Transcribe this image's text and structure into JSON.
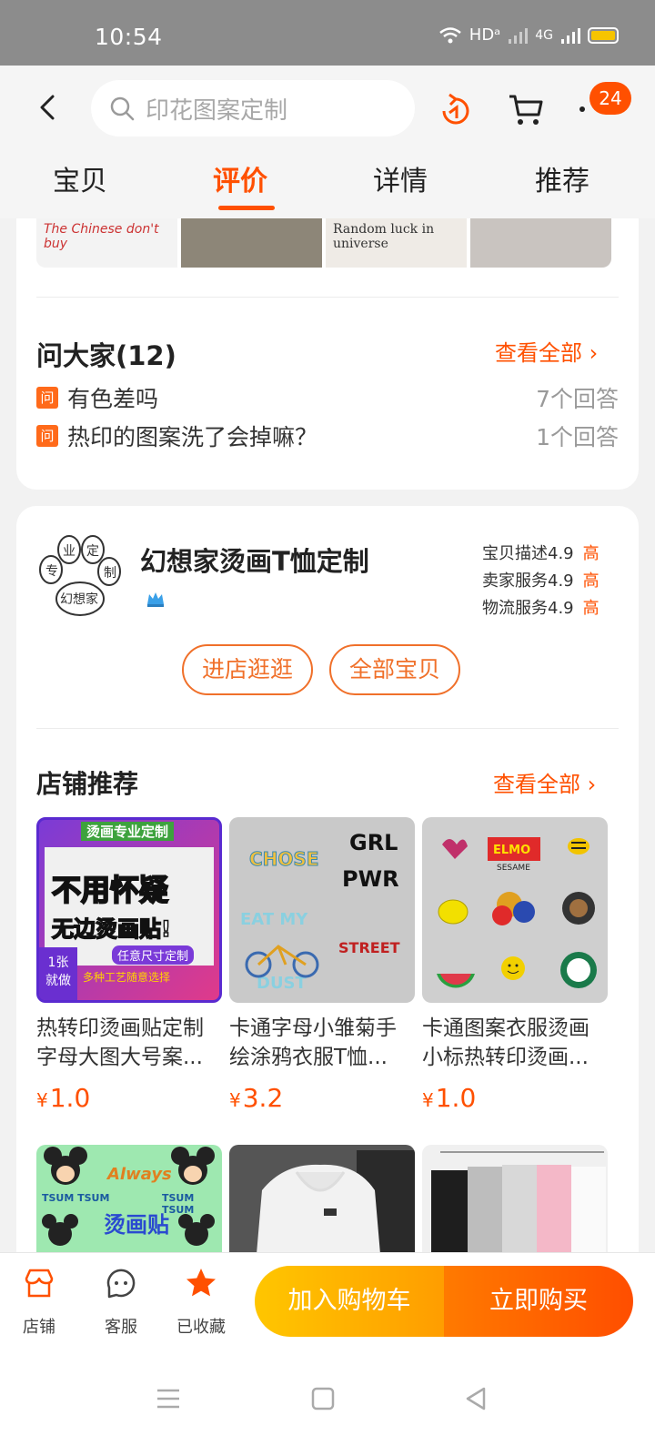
{
  "status_bar": {
    "time": "10:54",
    "network": "HDᵃ",
    "network2": "4G",
    "battery_color": "#f6c400"
  },
  "header": {
    "search_placeholder": "印花图案定制",
    "badge_count": "24",
    "tabs": [
      {
        "label": "宝贝"
      },
      {
        "label": "评价"
      },
      {
        "label": "详情"
      },
      {
        "label": "推荐"
      }
    ]
  },
  "reviews": {
    "thumb_texts": [
      "The Chinese don't buy",
      "",
      "Random luck in universe",
      ""
    ]
  },
  "qa": {
    "title": "问大家(12)",
    "see_all": "查看全部 ›",
    "q_icon": "问",
    "items": [
      {
        "question": "有色差吗",
        "answers": "7个回答"
      },
      {
        "question": "热印的图案洗了会掉嘛？",
        "answers": "1个回答"
      }
    ]
  },
  "shop": {
    "logo_text": [
      "业",
      "定",
      "专",
      "制",
      "幻想家"
    ],
    "name": "幻想家烫画T恤定制",
    "ratings": [
      {
        "label": "宝贝描述",
        "score": "4.9",
        "level": "高"
      },
      {
        "label": "卖家服务",
        "score": "4.9",
        "level": "高"
      },
      {
        "label": "物流服务",
        "score": "4.9",
        "level": "高"
      }
    ],
    "enter_store": "进店逛逛",
    "all_items": "全部宝贝",
    "rec_title": "店铺推荐",
    "rec_see_all": "查看全部 ›",
    "products": [
      {
        "name": "热转印烫画贴定制字母大图大号案...",
        "price": "1.0",
        "img_text": {
          "top": "烫画专业定制",
          "big1": "不用",
          "big2": "怀疑",
          "big3": "无边烫画贴!",
          "tag": "任意尺寸定制",
          "sub": "多种工艺随意选择",
          "badge1": "1张",
          "badge2": "就做"
        }
      },
      {
        "name": "卡通字母小雏菊手绘涂鸦衣服T恤...",
        "price": "3.2",
        "img_text": {
          "a": "CHOSE",
          "b": "GRL",
          "c": "PWR",
          "d": "EAT MY",
          "e": "DUST",
          "f": "STREET"
        }
      },
      {
        "name": "卡通图案衣服烫画小标热转印烫画...",
        "price": "1.0",
        "img_text": {
          "a": "ELMO",
          "b": "SESAME"
        }
      },
      {
        "name": "",
        "price": "",
        "img_text": {
          "a": "TSUM TSUM",
          "b": "烫画贴",
          "c": "Always",
          "d": "TSUM TSUM"
        }
      },
      {
        "name": "",
        "price": "",
        "img_text": {}
      },
      {
        "name": "",
        "price": "",
        "img_text": {}
      }
    ],
    "currency": "¥"
  },
  "bottom_bar": {
    "store": "店铺",
    "service": "客服",
    "favorited": "已收藏",
    "add_cart": "加入购物车",
    "buy_now": "立即购买"
  },
  "colors": {
    "accent": "#ff5000",
    "cart_gradient": "#ffc600",
    "buy_gradient": "#ff4e00"
  }
}
